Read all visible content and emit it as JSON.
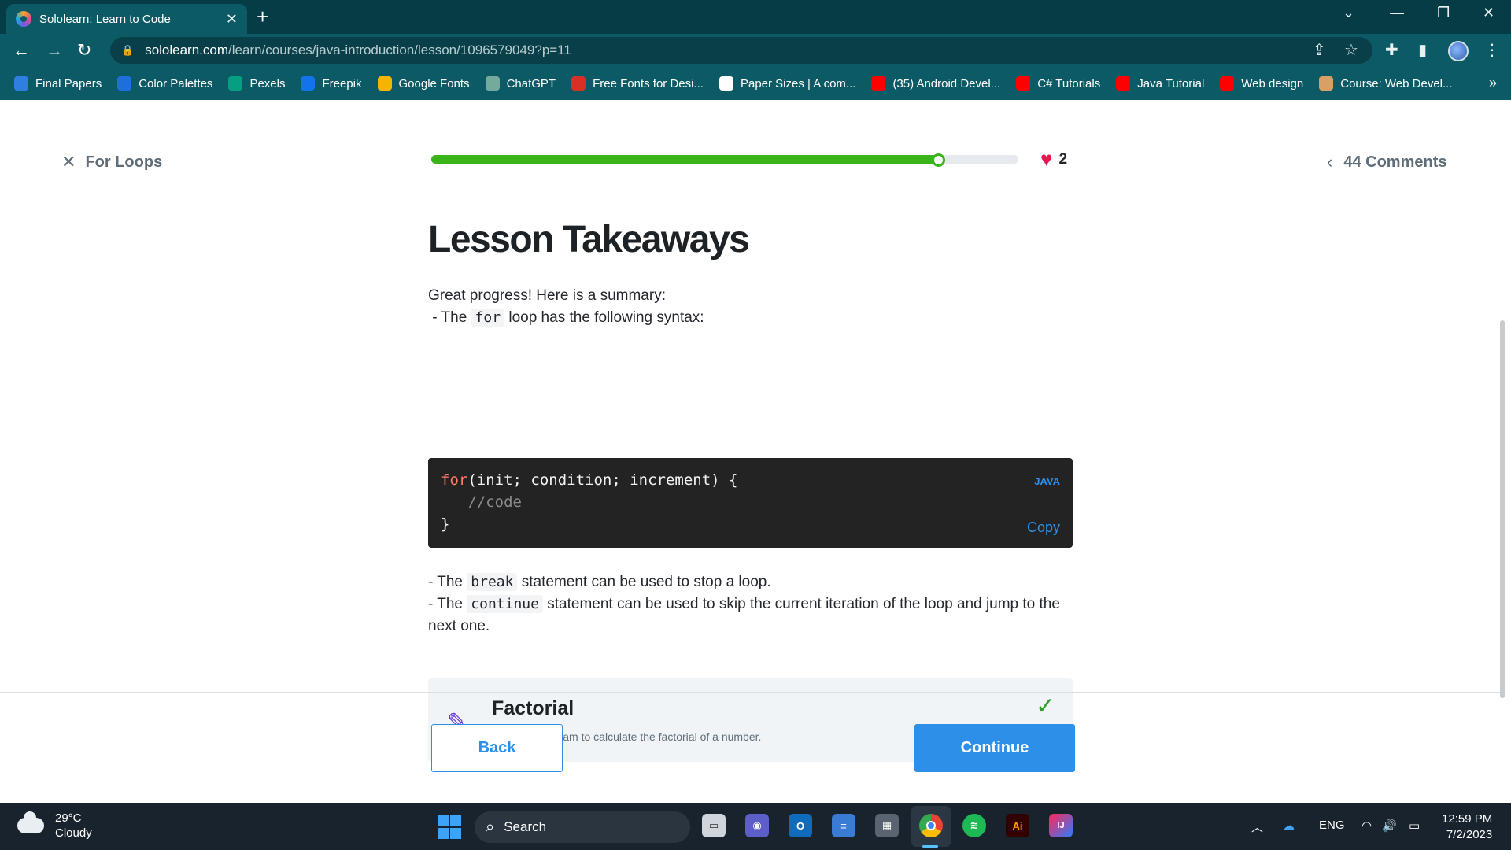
{
  "browser": {
    "tab_title": "Sololearn: Learn to Code",
    "tab_close": "✕",
    "new_tab": "+",
    "url_host": "sololearn.com",
    "url_path": "/learn/courses/java-introduction/lesson/1096579049?p=11",
    "bookmarks": [
      {
        "label": "Final Papers",
        "icon": "onedrive-icon",
        "color": "#2f7fe0"
      },
      {
        "label": "Color Palettes",
        "icon": "color-palettes-icon",
        "color": "#1e6fd9"
      },
      {
        "label": "Pexels",
        "icon": "pexels-icon",
        "color": "#05a081"
      },
      {
        "label": "Freepik",
        "icon": "freepik-icon",
        "color": "#1273eb"
      },
      {
        "label": "Google Fonts",
        "icon": "google-fonts-icon",
        "color": "#f4b400"
      },
      {
        "label": "ChatGPT",
        "icon": "chatgpt-icon",
        "color": "#74aa9c"
      },
      {
        "label": "Free Fonts for Desi...",
        "icon": "fonts-site-icon",
        "color": "#d93025"
      },
      {
        "label": "Paper Sizes | A com...",
        "icon": "paper-sizes-icon",
        "color": "#ffffff"
      },
      {
        "label": "(35) Android Devel...",
        "icon": "youtube-icon",
        "color": "#ff0000"
      },
      {
        "label": "C# Tutorials",
        "icon": "youtube-icon",
        "color": "#ff0000"
      },
      {
        "label": "Java Tutorial",
        "icon": "youtube-icon",
        "color": "#ff0000"
      },
      {
        "label": "Web design",
        "icon": "youtube-icon",
        "color": "#ff0000"
      },
      {
        "label": "Course: Web Devel...",
        "icon": "course-icon",
        "color": "#d9a066"
      }
    ],
    "bookmarks_more": "»"
  },
  "lesson": {
    "close_label": "For Loops",
    "progress_fraction": 0.87,
    "hearts": "2",
    "comments_label": "44 Comments",
    "title": "Lesson Takeaways",
    "intro_line": "Great progress! Here is a summary:",
    "syntax_prefix": " - The ",
    "syntax_code": "for",
    "syntax_suffix": " loop has the following syntax:",
    "code": {
      "line1_kw": "for",
      "line1_rest": "(init; condition; increment) {",
      "line2": "   //code",
      "line3": "}",
      "language": "JAVA",
      "copy_label": "Copy"
    },
    "break_prefix": "- The ",
    "break_code": "break",
    "break_suffix": " statement can be used to stop a loop.",
    "continue_prefix": "- The ",
    "continue_code": "continue",
    "continue_suffix": " statement can be used to skip the current iteration of the loop and jump to the next one.",
    "task": {
      "title": "Factorial",
      "description": "Create a program to calculate the factorial of a number."
    },
    "back_label": "Back",
    "continue_label": "Continue"
  },
  "taskbar": {
    "temperature": "29°C",
    "condition": "Cloudy",
    "search_label": "Search",
    "language": "ENG",
    "time": "12:59 PM",
    "date": "7/2/2023"
  },
  "colors": {
    "accent": "#2d8fe8",
    "progress": "#3bb41a",
    "heart": "#e5194f",
    "chrome": "#0c5a66"
  }
}
